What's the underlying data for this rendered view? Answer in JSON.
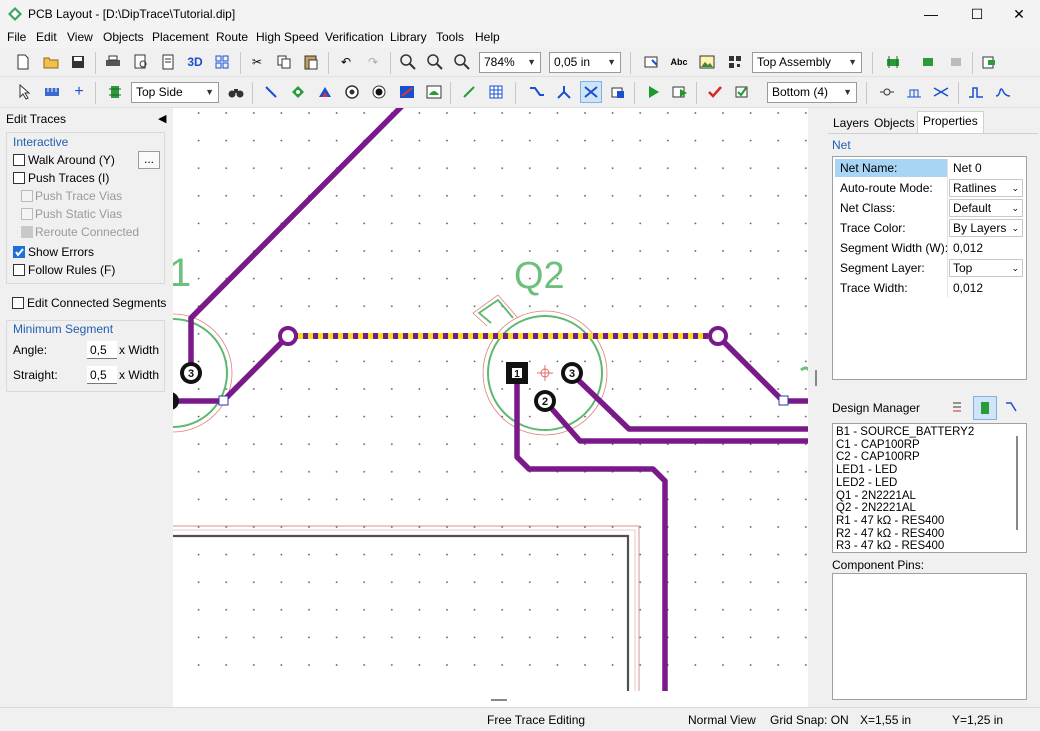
{
  "window": {
    "title": "PCB Layout - [D:\\DipTrace\\Tutorial.dip]",
    "minimize": "—",
    "maximize": "☐",
    "close": "✕"
  },
  "menu": [
    "File",
    "Edit",
    "View",
    "Objects",
    "Placement",
    "Route",
    "High Speed",
    "Verification",
    "Library",
    "Tools",
    "Help"
  ],
  "toolbar1": {
    "zoom": "784%",
    "grid": "0,05 in",
    "view_side": "Top Assembly"
  },
  "toolbar2": {
    "layer_side": "Top Side",
    "route_layer": "Bottom (4)",
    "threed": "3D"
  },
  "left": {
    "header": "Edit Traces",
    "interactive_title": "Interactive",
    "walk_around": "Walk Around (Y)",
    "walk_btn": "...",
    "push_traces": "Push Traces (I)",
    "push_trace_vias": "Push Trace Vias",
    "push_static_vias": "Push Static Vias",
    "reroute_connected": "Reroute Connected",
    "show_errors": "Show Errors",
    "follow_rules": "Follow Rules (F)",
    "edit_connected": "Edit Connected Segments",
    "min_seg_title": "Minimum Segment",
    "angle_label": "Angle:",
    "angle_value": "0,5",
    "straight_label": "Straight:",
    "straight_value": "0,5",
    "x_width": "x Width"
  },
  "canvas": {
    "q2_label": "Q2",
    "q1_partial": "1",
    "pin1": "1",
    "pin2": "2",
    "pin3": "3",
    "left_pin3": "3"
  },
  "right": {
    "tabs": [
      "Layers",
      "Objects",
      "Properties"
    ],
    "section": "Net",
    "props": [
      {
        "label": "Net Name:",
        "value": "Net 0"
      },
      {
        "label": "Auto-route Mode:",
        "value": "Ratlines"
      },
      {
        "label": "Net Class:",
        "value": "Default"
      },
      {
        "label": "Trace Color:",
        "value": "By Layers"
      },
      {
        "label": "Segment Width (W):",
        "value": "0,012"
      },
      {
        "label": "Segment Layer:",
        "value": "Top"
      },
      {
        "label": "Trace Width:",
        "value": "0,012"
      }
    ],
    "design_manager": "Design Manager",
    "components": [
      "B1 - SOURCE_BATTERY2",
      "C1 - CAP100RP",
      "C2 - CAP100RP",
      "LED1 - LED",
      "LED2 - LED",
      "Q1 - 2N2221AL",
      "Q2 - 2N2221AL",
      "R1 - 47 kΩ - RES400",
      "R2 - 47 kΩ - RES400",
      "R3 - 47 kΩ - RES400"
    ],
    "component_pins": "Component Pins:"
  },
  "status": {
    "mode": "Free Trace Editing",
    "view": "Normal View",
    "snap": "Grid Snap: ON",
    "x": "X=1,55 in",
    "y": "Y=1,25 in"
  },
  "colors": {
    "trace": "#7a1a8a",
    "ratsnest": "#f0e020",
    "silk": "#5fb86f",
    "accent": "#1e6fd9"
  }
}
